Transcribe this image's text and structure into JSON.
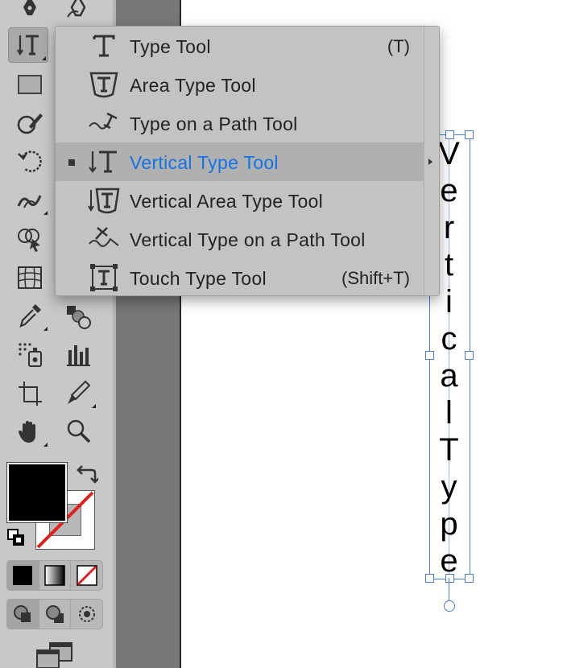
{
  "flyout": {
    "items": [
      {
        "label": "Type Tool",
        "shortcut": "(T)",
        "icon": "type-icon"
      },
      {
        "label": "Area Type Tool",
        "shortcut": "",
        "icon": "area-type-icon"
      },
      {
        "label": "Type on a Path Tool",
        "shortcut": "",
        "icon": "type-on-path-icon"
      },
      {
        "label": "Vertical Type Tool",
        "shortcut": "",
        "icon": "vertical-type-icon",
        "active": true
      },
      {
        "label": "Vertical Area Type Tool",
        "shortcut": "",
        "icon": "vertical-area-type-icon"
      },
      {
        "label": "Vertical Type on a Path Tool",
        "shortcut": "",
        "icon": "vertical-type-on-path-icon"
      },
      {
        "label": "Touch Type Tool",
        "shortcut": "(Shift+T)",
        "icon": "touch-type-icon"
      }
    ]
  },
  "canvas": {
    "vertical_text": [
      "V",
      "e",
      "r",
      "t",
      "i",
      "c",
      "a",
      "l",
      "T",
      "y",
      "p",
      "e"
    ]
  },
  "colors": {
    "accent": "#1473e6",
    "selection": "#4a7bd0",
    "none_stroke": "#e02020"
  },
  "toolbar": {
    "tools": [
      "pen-icon",
      "curvature-pen-icon",
      "vertical-type-icon",
      "rectangle-icon",
      "shaper-icon",
      "rotate-icon",
      "warp-icon",
      "shape-builder-icon",
      "perspective-grid-icon",
      "eyedropper-icon",
      "blend-icon",
      "symbol-sprayer-icon",
      "column-graph-icon",
      "artboard-icon",
      "slice-icon",
      "hand-icon",
      "zoom-icon"
    ]
  }
}
